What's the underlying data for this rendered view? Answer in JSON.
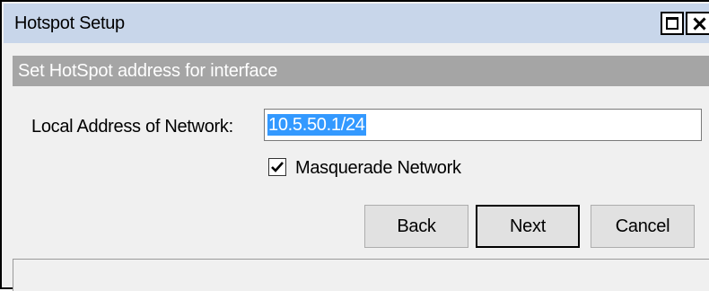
{
  "window": {
    "title": "Hotspot Setup",
    "maximize_icon": "maximize-icon",
    "close_icon": "close-icon"
  },
  "step": {
    "header": "Set HotSpot address for interface"
  },
  "form": {
    "local_address_label": "Local Address of Network:",
    "local_address_value": "10.5.50.1/24",
    "masquerade": {
      "label": "Masquerade Network",
      "checked": true
    }
  },
  "buttons": {
    "back_label": "Back",
    "next_label": "Next",
    "cancel_label": "Cancel"
  },
  "colors": {
    "titlebar": "#c8d6ea",
    "subheader": "#a5a5a5",
    "selection": "#3399ff"
  }
}
